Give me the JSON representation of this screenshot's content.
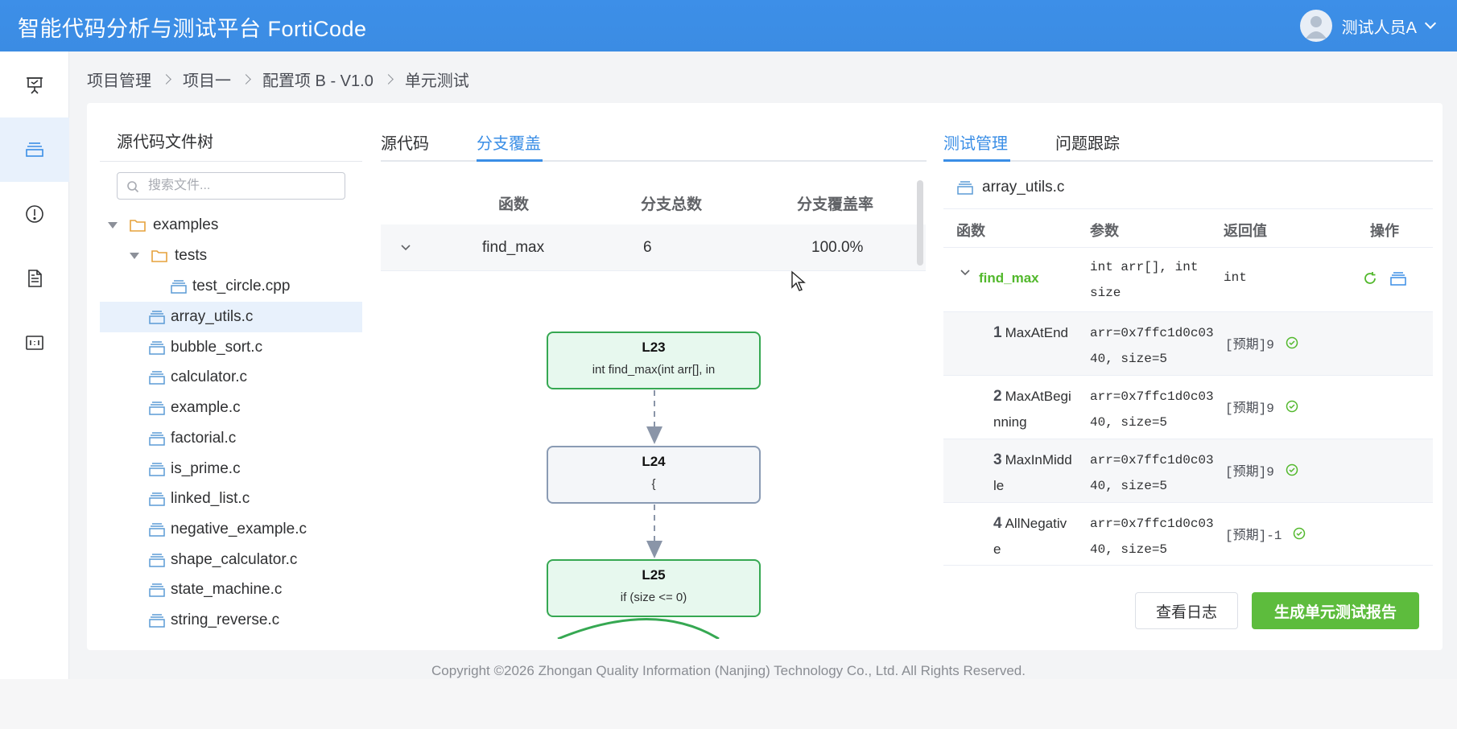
{
  "app": {
    "title": "智能代码分析与测试平台 FortiCode"
  },
  "user": {
    "name": "测试人员A",
    "avatar_icon": "user-avatar-icon"
  },
  "sidebar": [
    {
      "icon": "presentation-board-icon",
      "active": false
    },
    {
      "icon": "stack-layers-icon",
      "active": true
    },
    {
      "icon": "alert-circle-icon",
      "active": false
    },
    {
      "icon": "document-icon",
      "active": false
    },
    {
      "icon": "binary-data-icon",
      "active": false
    }
  ],
  "breadcrumb": [
    "项目管理",
    "项目一",
    "配置项 B - V1.0",
    "单元测试"
  ],
  "file_tree": {
    "title": "源代码文件树",
    "search_placeholder": "搜索文件...",
    "folders": {
      "examples": "examples",
      "tests": "tests"
    },
    "test_file": "test_circle.cpp",
    "files": [
      "array_utils.c",
      "bubble_sort.c",
      "calculator.c",
      "example.c",
      "factorial.c",
      "is_prime.c",
      "linked_list.c",
      "negative_example.c",
      "shape_calculator.c",
      "state_machine.c",
      "string_reverse.c"
    ],
    "selected": "array_utils.c"
  },
  "center": {
    "tabs": [
      "源代码",
      "分支覆盖"
    ],
    "active_tab": "分支覆盖",
    "columns": [
      "函数",
      "分支总数",
      "分支覆盖率"
    ],
    "row": {
      "function": "find_max",
      "branch_total": "6",
      "coverage": "100.0%"
    },
    "nodes": [
      {
        "label": "L23",
        "code": "int find_max(int arr[], in",
        "status": "covered"
      },
      {
        "label": "L24",
        "code": "{",
        "status": "neutral"
      },
      {
        "label": "L25",
        "code": "if (size <= 0)",
        "status": "covered"
      }
    ]
  },
  "right": {
    "tabs": [
      "测试管理",
      "问题跟踪"
    ],
    "active_tab": "测试管理",
    "file": "array_utils.c",
    "columns": [
      "函数",
      "参数",
      "返回值",
      "操作"
    ],
    "function": {
      "name": "find_max",
      "params": "int arr[], int size",
      "returns": "int"
    },
    "test_cases": [
      {
        "num": "1",
        "name": "MaxAtEnd",
        "args": "arr=0x7ffc1d0c0340, size=5",
        "expected": "[预期]9"
      },
      {
        "num": "2",
        "name": "MaxAtBeginning",
        "args": "arr=0x7ffc1d0c0340, size=5",
        "expected": "[预期]9"
      },
      {
        "num": "3",
        "name": "MaxInMiddle",
        "args": "arr=0x7ffc1d0c0340, size=5",
        "expected": "[预期]9"
      },
      {
        "num": "4",
        "name": "AllNegative",
        "args": "arr=0x7ffc1d0c0340, size=5",
        "expected": "[预期]-1"
      }
    ],
    "buttons": {
      "view_log": "查看日志",
      "generate_report": "生成单元测试报告"
    }
  },
  "colors": {
    "primary": "#3a8ee6",
    "success": "#5dbc3d",
    "function_green": "#52b82c"
  },
  "footer": "Copyright ©2026 Zhongan Quality Information (Nanjing) Technology Co., Ltd. All Rights Reserved."
}
